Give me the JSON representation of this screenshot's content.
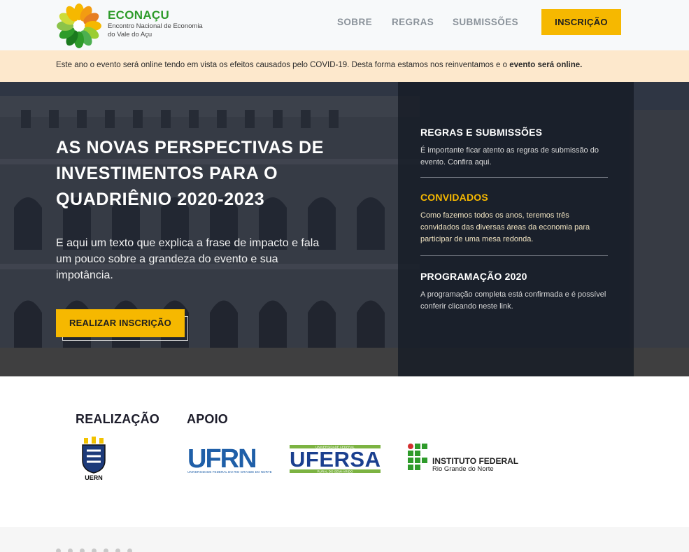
{
  "header": {
    "brand_name": "ECONAÇU",
    "brand_subtitle": "Encontro Nacional de Economia do Vale do Açu",
    "nav": [
      "SOBRE",
      "REGRAS",
      "SUBMISSÕES"
    ],
    "cta_label": "INSCRIÇÃO"
  },
  "notice": {
    "text": "Este ano o evento será online tendo em vista os efeitos causados pelo COVID-19. Desta forma estamos nos reinventamos e o ",
    "bold": "evento será online."
  },
  "hero": {
    "title": "AS NOVAS PERSPECTIVAS DE INVESTIMENTOS PARA O QUADRIÊNIO 2020-2023",
    "text": "E aqui um texto que explica a frase de impacto e fala um pouco sobre a grandeza do evento e sua impotância.",
    "button_label": "REALIZAR INSCRIÇÃO"
  },
  "panel": {
    "sections": [
      {
        "heading": "REGRAS E SUBMISSÕES",
        "text": "É importante ficar atento as regras de submissão do evento. Confira aqui."
      },
      {
        "heading": "CONVIDADOS",
        "text": "Como fazemos todos os anos, teremos três convidados das diversas áreas da economia para participar de uma mesa redonda."
      },
      {
        "heading": "PROGRAMAÇÃO 2020",
        "text": "A programação completa está confirmada e é possível conferir clicando neste link."
      }
    ]
  },
  "partners": {
    "realizacao_label": "REALIZAÇÃO",
    "apoio_label": "APOIO",
    "uern_text": "UERN",
    "ufrn_text": "UFRN",
    "ufrn_caption": "UNIVERSIDADE FEDERAL DO RIO GRANDE DO NORTE",
    "ufersa_text": "UFERSA",
    "ufersa_top": "UNIVERSIDADE FEDERAL",
    "ufersa_bottom": "RURAL DO SEMI-ÁRIDO",
    "ifrn_text": "INSTITUTO FEDERAL",
    "ifrn_sub": "Rio Grande do Norte"
  },
  "colors": {
    "accent": "#f6b800",
    "brand_green": "#2e9b2a",
    "notice_bg": "#fde8cc",
    "panel_bg": "#161c26"
  }
}
